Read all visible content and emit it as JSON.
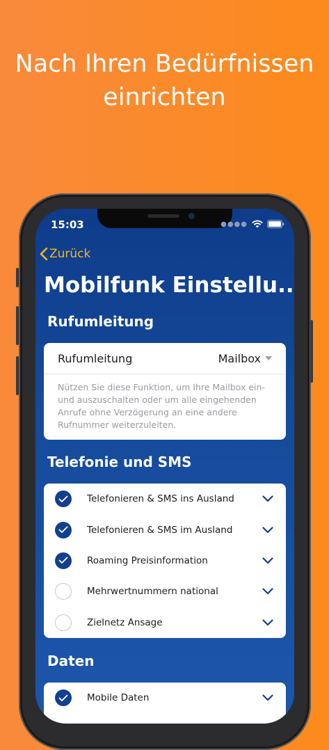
{
  "headline": {
    "line1": "Nach Ihren Bedürfnissen",
    "line2": "einrichten"
  },
  "status_bar": {
    "time": "15:03"
  },
  "nav": {
    "back_label": "Zurück"
  },
  "page": {
    "title": "Mobilfunk Einstellu..."
  },
  "sections": {
    "call_forwarding": {
      "heading": "Rufumleitung",
      "row_label": "Rufumleitung",
      "row_value": "Mailbox",
      "description": "Nützen Sie diese Funktion, um Ihre Mailbox ein- und auszuschalten oder um alle eingehenden Anrufe ohne Verzögerung an eine andere Rufnummer weiterzuleiten."
    },
    "telephony": {
      "heading": "Telefonie und SMS",
      "items": [
        {
          "label": "Telefonieren & SMS ins Ausland",
          "checked": true
        },
        {
          "label": "Telefonieren & SMS im Ausland",
          "checked": true
        },
        {
          "label": "Roaming Preisinformation",
          "checked": true
        },
        {
          "label": "Mehrwertnummern national",
          "checked": false
        },
        {
          "label": "Zielnetz Ansage",
          "checked": false
        }
      ]
    },
    "data": {
      "heading": "Daten",
      "items": [
        {
          "label": "Mobile Daten",
          "checked": true
        }
      ]
    }
  },
  "colors": {
    "accent": "#f5b81c",
    "primary": "#123f8f",
    "background": "#fb8a2a"
  }
}
